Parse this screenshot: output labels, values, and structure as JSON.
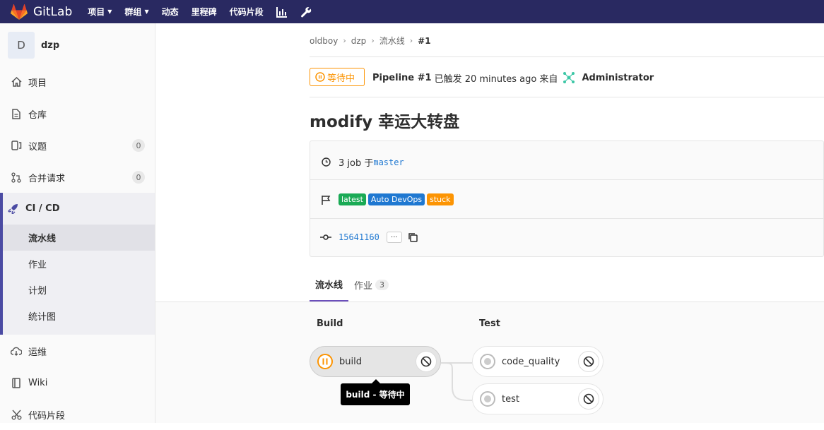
{
  "navbar": {
    "brand": "GitLab",
    "items": [
      {
        "label": "项目",
        "caret": true
      },
      {
        "label": "群组",
        "caret": true
      },
      {
        "label": "动态",
        "caret": false
      },
      {
        "label": "里程碑",
        "caret": false
      },
      {
        "label": "代码片段",
        "caret": false
      }
    ],
    "bg_color": "#292961"
  },
  "sidebar": {
    "avatar_letter": "D",
    "project_name": "dzp",
    "items": [
      {
        "label": "项目",
        "icon": "home-icon"
      },
      {
        "label": "仓库",
        "icon": "doc-icon"
      },
      {
        "label": "议题",
        "icon": "issues-icon",
        "count": "0"
      },
      {
        "label": "合并请求",
        "icon": "merge-request-icon",
        "count": "0"
      },
      {
        "label": "CI / CD",
        "icon": "rocket-icon"
      },
      {
        "label": "运维",
        "icon": "cloud-icon"
      },
      {
        "label": "Wiki",
        "icon": "book-icon"
      },
      {
        "label": "代码片段",
        "icon": "scissors-icon"
      }
    ],
    "cicd_sub": [
      {
        "label": "流水线",
        "active": true
      },
      {
        "label": "作业",
        "active": false
      },
      {
        "label": "计划",
        "active": false
      },
      {
        "label": "统计图",
        "active": false
      }
    ]
  },
  "breadcrumb": [
    "oldboy",
    "dzp",
    "流水线",
    "#1"
  ],
  "pipeline": {
    "status": "等待中",
    "status_color": "#fc9403",
    "title": "Pipeline #1",
    "triggered": "已触发 20 minutes ago 来自",
    "user": "Administrator",
    "commit_title": "modify 幸运大转盘",
    "jobs_text": "3 job 于",
    "branch": "master",
    "labels": [
      {
        "text": "latest",
        "color": "#1aaa55"
      },
      {
        "text": "Auto DevOps",
        "color": "#1f78d1"
      },
      {
        "text": "stuck",
        "color": "#fc9403"
      }
    ],
    "commit_sha": "15641160",
    "ellipsis": "···"
  },
  "tabs": [
    {
      "label": "流水线",
      "active": true
    },
    {
      "label": "作业",
      "count": "3",
      "active": false
    }
  ],
  "graph": {
    "stages": [
      {
        "title": "Build",
        "jobs": [
          {
            "name": "build",
            "status": "pending"
          }
        ]
      },
      {
        "title": "Test",
        "jobs": [
          {
            "name": "code_quality",
            "status": "created"
          },
          {
            "name": "test",
            "status": "created"
          }
        ]
      }
    ],
    "tooltip": "build - 等待中"
  }
}
